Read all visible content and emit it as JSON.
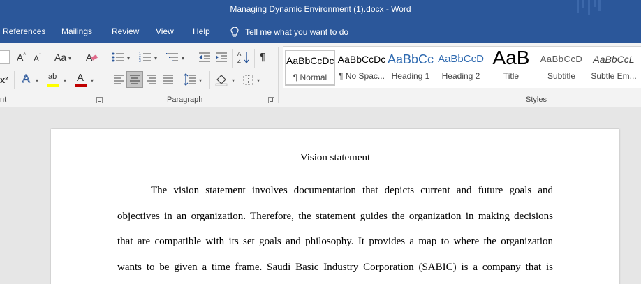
{
  "window": {
    "title": "Managing Dynamic Environment (1).docx  -  Word"
  },
  "tabs": [
    {
      "label": "References"
    },
    {
      "label": "Mailings"
    },
    {
      "label": "Review"
    },
    {
      "label": "View"
    },
    {
      "label": "Help"
    }
  ],
  "tell_me": {
    "placeholder": "Tell me what you want to do",
    "icon": "lightbulb-icon"
  },
  "ribbon": {
    "font_group": {
      "label": "nt",
      "grow_font": "A",
      "shrink_font": "A",
      "change_case": "Aa",
      "superscript": "x²",
      "text_effects": "A",
      "highlight": "ab",
      "font_color": "A",
      "colors": {
        "highlight": "#ffff00",
        "font_color": "#c00000",
        "text_effects": "#2b579a"
      }
    },
    "paragraph_group": {
      "label": "Paragraph",
      "show_marks": "¶",
      "sort": "A Z"
    },
    "styles_group": {
      "label": "Styles",
      "items": [
        {
          "preview": "AaBbCcDc",
          "name": "¶ Normal",
          "color": "#000000"
        },
        {
          "preview": "AaBbCcDc",
          "name": "¶ No Spac...",
          "color": "#000000"
        },
        {
          "preview": "AaBbCc",
          "name": "Heading 1",
          "color": "#2f6ab0"
        },
        {
          "preview": "AaBbCcD",
          "name": "Heading 2",
          "color": "#2f6ab0"
        },
        {
          "preview": "AaB",
          "name": "Title",
          "color": "#000000"
        },
        {
          "preview": "AaBbCcD",
          "name": "Subtitle",
          "color": "#595959"
        },
        {
          "preview": "AaBbCcL",
          "name": "Subtle Em...",
          "color": "#404040"
        }
      ]
    }
  },
  "document": {
    "heading": "Vision statement",
    "lines": [
      "The vision statement involves documentation that depicts current and future goals and",
      "objectives in an organization. Therefore, the statement guides the organization in making decisions",
      "that are compatible with its set goals and philosophy. It provides a map to where the organization",
      "wants to be given a time frame. Saudi Basic Industry Corporation (SABIC) is a company that is"
    ]
  }
}
